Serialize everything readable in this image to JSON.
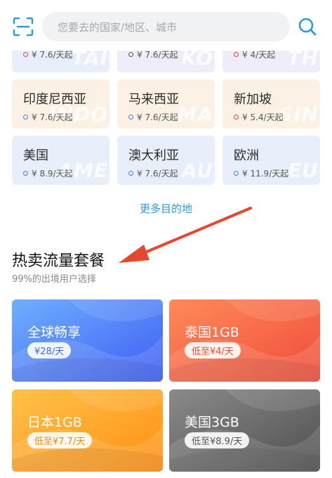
{
  "search": {
    "placeholder": "您要去的国家/地区、城市"
  },
  "destinations": [
    {
      "name": "",
      "price": "¥ 7.6/天起",
      "dot": "red",
      "theme": "blue",
      "wm": "TAI"
    },
    {
      "name": "",
      "price": "¥ 7.6/天起",
      "dot": "dark",
      "theme": "lav",
      "wm": "KO"
    },
    {
      "name": "",
      "price": "¥ 4/天起",
      "dot": "red",
      "theme": "lav",
      "wm": "TH"
    },
    {
      "name": "印度尼西亚",
      "price": "¥ 7.6/天起",
      "dot": "blue",
      "theme": "beige",
      "wm": "INDO"
    },
    {
      "name": "马来西亚",
      "price": "¥ 7.6/天起",
      "dot": "blue",
      "theme": "beige",
      "wm": "MA"
    },
    {
      "name": "新加坡",
      "price": "¥ 5.4/天起",
      "dot": "red",
      "theme": "beige",
      "wm": "SIN"
    },
    {
      "name": "美国",
      "price": "¥ 8.9/天起",
      "dot": "blue",
      "theme": "blue",
      "wm": "AME"
    },
    {
      "name": "澳大利亚",
      "price": "¥ 7.6/天起",
      "dot": "blue",
      "theme": "blue",
      "wm": "AU"
    },
    {
      "name": "欧洲",
      "price": "¥ 11.9/天起",
      "dot": "blue",
      "theme": "blue",
      "wm": "EU"
    }
  ],
  "more_link": "更多目的地",
  "hot": {
    "title": "热卖流量套餐",
    "subtitle": "99%的出境用户选择"
  },
  "packages": [
    {
      "name": "全球畅享",
      "price": "¥28/天",
      "price_color": "#3b6ef0",
      "colors": [
        "#6fb0ff",
        "#3f5cf4"
      ]
    },
    {
      "name": "泰国1GB",
      "price": "低至¥4/天",
      "price_color": "#e8502c",
      "colors": [
        "#ff8a5a",
        "#f04c3a"
      ]
    },
    {
      "name": "日本1GB",
      "price": "低至¥7.7/天",
      "price_color": "#f08a12",
      "colors": [
        "#ffc24a",
        "#ff8f12"
      ]
    },
    {
      "name": "美国3GB",
      "price": "低至¥8.9/天",
      "price_color": "#555555",
      "colors": [
        "#8a8a8a",
        "#4f4f4f"
      ]
    }
  ],
  "colors": {
    "accent": "#2c9bd6",
    "arrow": "#e8462e"
  },
  "icons": {
    "scan": "scan-icon",
    "search": "search-icon"
  }
}
